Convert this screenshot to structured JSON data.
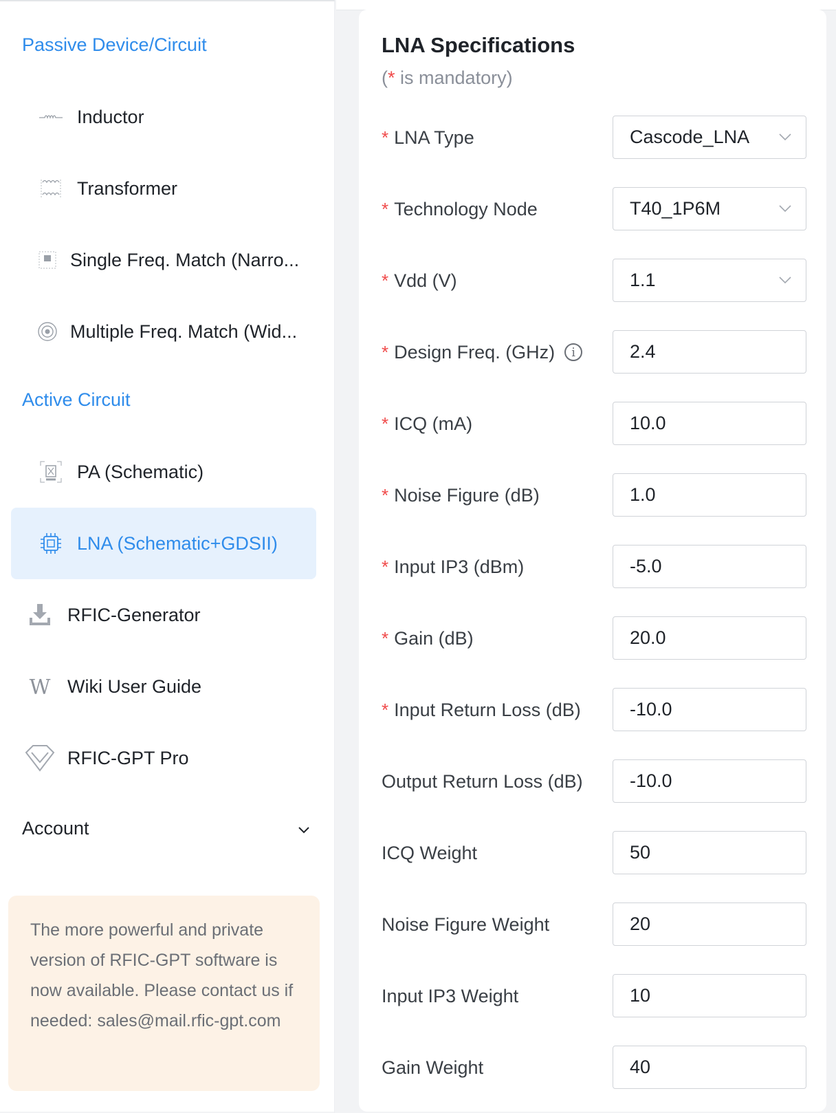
{
  "sidebar": {
    "passive_title": "Passive Device/Circuit",
    "active_title": "Active Circuit",
    "items": [
      {
        "label": "Inductor",
        "icon": "inductor-icon"
      },
      {
        "label": "Transformer",
        "icon": "transformer-icon"
      },
      {
        "label": "Single Freq. Match (Narro...",
        "icon": "single-match-icon"
      },
      {
        "label": "Multiple Freq. Match (Wid...",
        "icon": "multi-match-icon"
      },
      {
        "label": "PA (Schematic)",
        "icon": "pa-chip-icon"
      },
      {
        "label": "LNA (Schematic+GDSII)",
        "icon": "lna-chip-icon",
        "active": true
      },
      {
        "label": "RFIC-Generator",
        "icon": "download-icon"
      },
      {
        "label": "Wiki User Guide",
        "icon": "wiki-icon"
      },
      {
        "label": "RFIC-GPT Pro",
        "icon": "diamond-icon"
      }
    ],
    "account_label": "Account",
    "promo_text": "The more powerful and private version of RFIC-GPT software is now available. Please contact us if needed: sales@mail.rfic-gpt.com"
  },
  "form": {
    "title": "LNA Specifications",
    "subtitle_open": "(",
    "subtitle_star": "*",
    "subtitle_rest": " is mandatory)",
    "fields": [
      {
        "label": "LNA Type",
        "value": "Cascode_LNA",
        "required": true,
        "type": "select"
      },
      {
        "label": "Technology Node",
        "value": "T40_1P6M",
        "required": true,
        "type": "select"
      },
      {
        "label": "Vdd (V)",
        "value": "1.1",
        "required": true,
        "type": "select"
      },
      {
        "label": "Design Freq. (GHz)",
        "value": "2.4",
        "required": true,
        "type": "input",
        "info": "i"
      },
      {
        "label": "ICQ (mA)",
        "value": "10.0",
        "required": true,
        "type": "input"
      },
      {
        "label": "Noise Figure (dB)",
        "value": "1.0",
        "required": true,
        "type": "input"
      },
      {
        "label": "Input IP3 (dBm)",
        "value": "-5.0",
        "required": true,
        "type": "input"
      },
      {
        "label": "Gain (dB)",
        "value": "20.0",
        "required": true,
        "type": "input"
      },
      {
        "label": "Input Return Loss (dB)",
        "value": "-10.0",
        "required": true,
        "type": "input"
      },
      {
        "label": "Output Return Loss (dB)",
        "value": "-10.0",
        "required": false,
        "type": "input"
      },
      {
        "label": "ICQ Weight",
        "value": "50",
        "required": false,
        "type": "input"
      },
      {
        "label": "Noise Figure Weight",
        "value": "20",
        "required": false,
        "type": "input"
      },
      {
        "label": "Input IP3 Weight",
        "value": "10",
        "required": false,
        "type": "input"
      },
      {
        "label": "Gain Weight",
        "value": "40",
        "required": false,
        "type": "input"
      }
    ],
    "required_mark": "*"
  },
  "colors": {
    "accent": "#2f8ceb",
    "active_bg": "#e6f1fd",
    "required": "#f04a4a",
    "promo_bg": "#fdf2e6"
  }
}
